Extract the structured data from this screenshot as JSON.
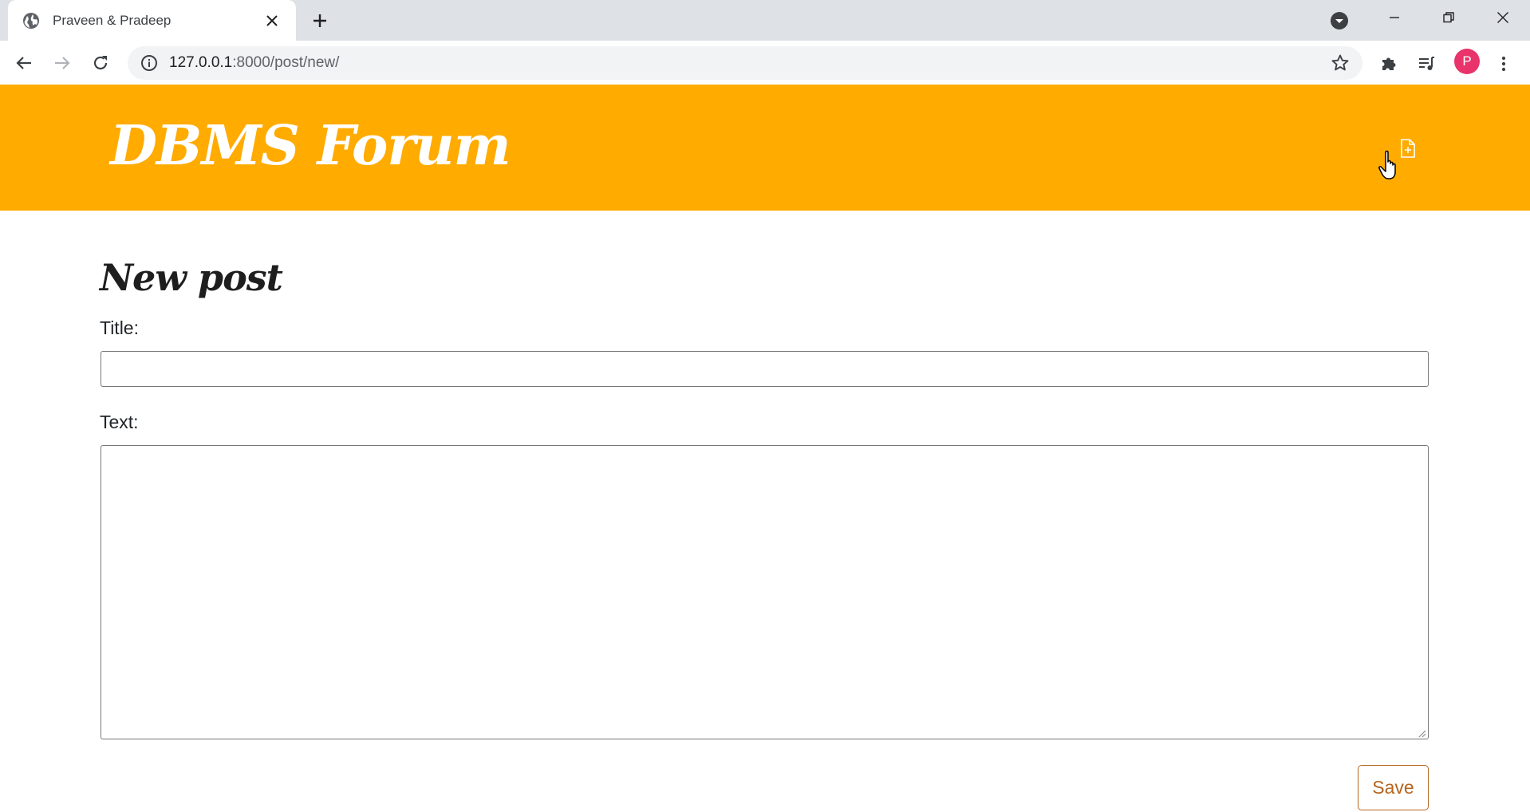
{
  "browser": {
    "tab_title": "Praveen & Pradeep",
    "url_host": "127.0.0.1",
    "url_path": ":8000/post/new/",
    "profile_initial": "P"
  },
  "header": {
    "site_title": "DBMS Forum"
  },
  "form": {
    "heading": "New post",
    "title_label": "Title:",
    "title_value": "",
    "text_label": "Text:",
    "text_value": "",
    "save_label": "Save"
  },
  "colors": {
    "header_bg": "#ffab00",
    "avatar_bg": "#e8336b",
    "save_text": "#b5651d"
  }
}
